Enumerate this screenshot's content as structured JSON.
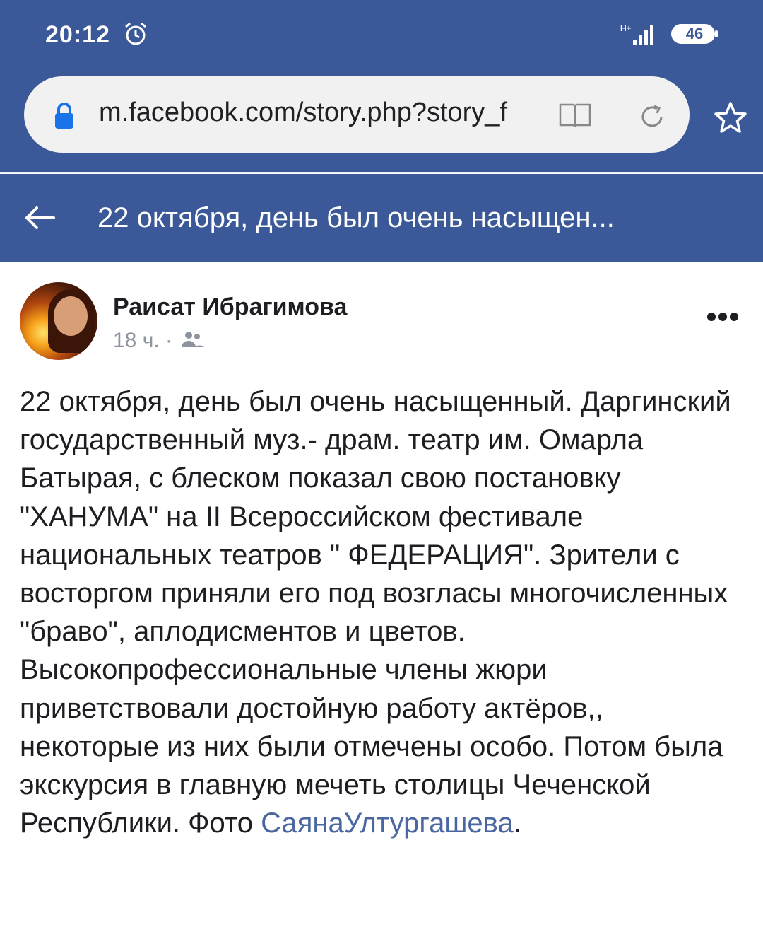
{
  "status_bar": {
    "time": "20:12",
    "signal_label": "H+",
    "battery": "46"
  },
  "browser": {
    "url": "m.facebook.com/story.php?story_f"
  },
  "header": {
    "title": "22 октября, день был очень насыщен..."
  },
  "post": {
    "author": "Раисат Ибрагимова",
    "time": "18 ч.",
    "separator": " · ",
    "text": "22 октября, день был очень насыщенный. Даргинский государственный муз.- драм. театр им. Омарла Батырая, с блеском показал свою постановку \"ХАНУМА\" на II Всероссийском фестивале национальных театров \" ФЕДЕРАЦИЯ\". Зрители с восторгом приняли его под возгласы многочисленных \"браво\", аплодисментов и цветов. Высокопрофессиональные члены жюри приветствовали достойную работу актёров,, некоторые из них были отмечены особо. Потом была экскурсия в главную мечеть столицы Чеченской Республики. Фото ",
    "mention": "СаянаУлтургашева",
    "text_end": "."
  },
  "colors": {
    "brand": "#3b5998",
    "mention": "#4b67a1",
    "meta": "#8d949e"
  }
}
